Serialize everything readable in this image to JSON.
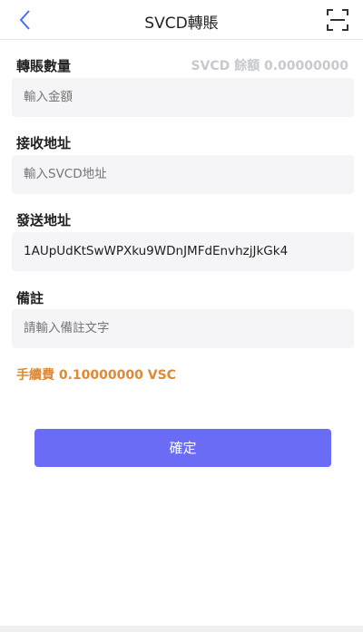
{
  "header": {
    "title": "SVCD轉賬",
    "back_icon": "chevron-left-icon",
    "scan_icon": "scan-icon"
  },
  "form": {
    "amount_label": "轉賬數量",
    "balance_text": "SVCD 餘額 0.00000000",
    "amount_placeholder": "輸入金額",
    "receive_label": "接收地址",
    "receive_placeholder": "輸入SVCD地址",
    "send_label": "發送地址",
    "send_value": "1AUpUdKtSwWPXku9WDnJMFdEnvhzjJkGk4",
    "note_label": "備註",
    "note_placeholder": "請輸入備註文字",
    "fee_text": "手續費 0.10000000 VSC"
  },
  "actions": {
    "confirm_label": "確定"
  },
  "colors": {
    "accent": "#6a6cf6",
    "back_icon": "#4a6cf7",
    "fee": "#e08934",
    "field_bg": "#f5f5f8"
  }
}
